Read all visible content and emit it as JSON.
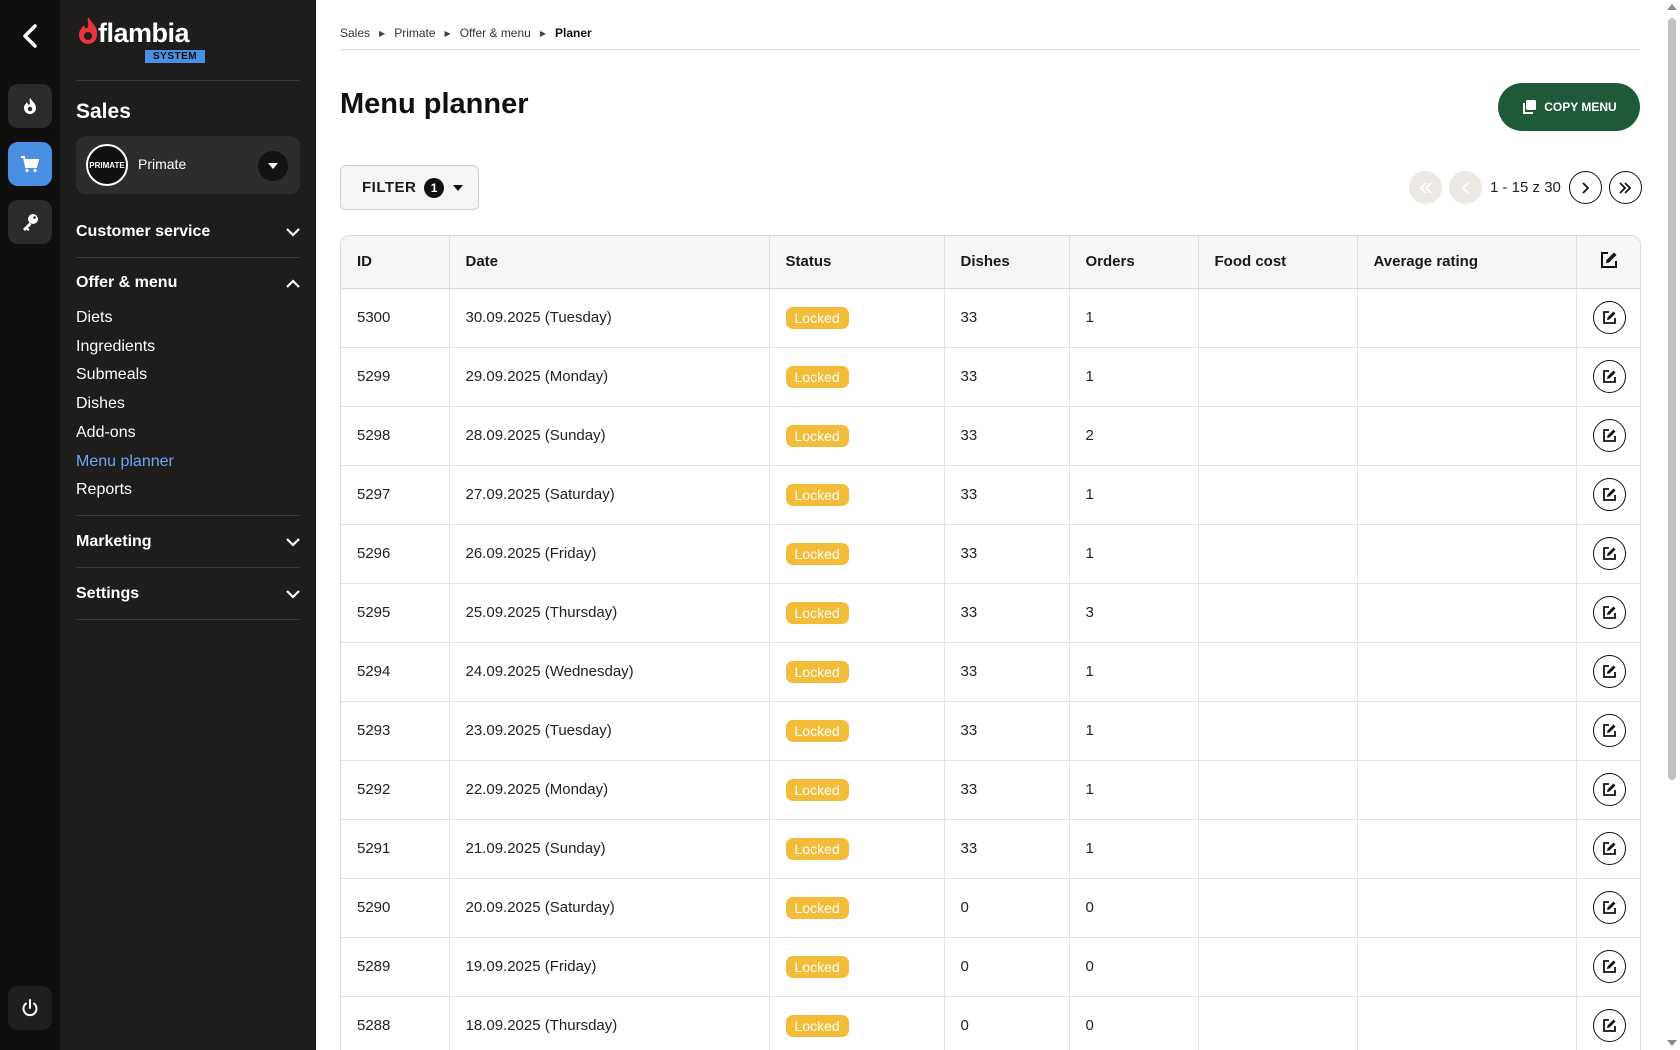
{
  "brand": {
    "name": "flambia",
    "badge": "SYSTEM"
  },
  "sidebar": {
    "section": "Sales",
    "company": {
      "name": "Primate",
      "avatar": "PRIMATE"
    },
    "groups": [
      {
        "label": "Customer service",
        "expanded": false
      },
      {
        "label": "Offer & menu",
        "expanded": true,
        "items": [
          "Diets",
          "Ingredients",
          "Submeals",
          "Dishes",
          "Add-ons",
          "Menu planner",
          "Reports"
        ],
        "active": "Menu planner"
      },
      {
        "label": "Marketing",
        "expanded": false
      },
      {
        "label": "Settings",
        "expanded": false
      }
    ]
  },
  "breadcrumb": [
    "Sales",
    "Primate",
    "Offer & menu",
    "Planer"
  ],
  "page": {
    "title": "Menu planner",
    "copy_button": "COPY MENU",
    "filter_label": "FILTER",
    "filter_count": "1",
    "pagination": "1 - 15 z 30"
  },
  "table": {
    "columns": [
      "ID",
      "Date",
      "Status",
      "Dishes",
      "Orders",
      "Food cost",
      "Average rating"
    ],
    "rows": [
      {
        "id": "5300",
        "date": "30.09.2025 (Tuesday)",
        "status": "Locked",
        "dishes": "33",
        "orders": "1",
        "food_cost": "",
        "rating": ""
      },
      {
        "id": "5299",
        "date": "29.09.2025 (Monday)",
        "status": "Locked",
        "dishes": "33",
        "orders": "1",
        "food_cost": "",
        "rating": ""
      },
      {
        "id": "5298",
        "date": "28.09.2025 (Sunday)",
        "status": "Locked",
        "dishes": "33",
        "orders": "2",
        "food_cost": "",
        "rating": ""
      },
      {
        "id": "5297",
        "date": "27.09.2025 (Saturday)",
        "status": "Locked",
        "dishes": "33",
        "orders": "1",
        "food_cost": "",
        "rating": ""
      },
      {
        "id": "5296",
        "date": "26.09.2025 (Friday)",
        "status": "Locked",
        "dishes": "33",
        "orders": "1",
        "food_cost": "",
        "rating": ""
      },
      {
        "id": "5295",
        "date": "25.09.2025 (Thursday)",
        "status": "Locked",
        "dishes": "33",
        "orders": "3",
        "food_cost": "",
        "rating": ""
      },
      {
        "id": "5294",
        "date": "24.09.2025 (Wednesday)",
        "status": "Locked",
        "dishes": "33",
        "orders": "1",
        "food_cost": "",
        "rating": ""
      },
      {
        "id": "5293",
        "date": "23.09.2025 (Tuesday)",
        "status": "Locked",
        "dishes": "33",
        "orders": "1",
        "food_cost": "",
        "rating": ""
      },
      {
        "id": "5292",
        "date": "22.09.2025 (Monday)",
        "status": "Locked",
        "dishes": "33",
        "orders": "1",
        "food_cost": "",
        "rating": ""
      },
      {
        "id": "5291",
        "date": "21.09.2025 (Sunday)",
        "status": "Locked",
        "dishes": "33",
        "orders": "1",
        "food_cost": "",
        "rating": ""
      },
      {
        "id": "5290",
        "date": "20.09.2025 (Saturday)",
        "status": "Locked",
        "dishes": "0",
        "orders": "0",
        "food_cost": "",
        "rating": ""
      },
      {
        "id": "5289",
        "date": "19.09.2025 (Friday)",
        "status": "Locked",
        "dishes": "0",
        "orders": "0",
        "food_cost": "",
        "rating": ""
      },
      {
        "id": "5288",
        "date": "18.09.2025 (Thursday)",
        "status": "Locked",
        "dishes": "0",
        "orders": "0",
        "food_cost": "",
        "rating": ""
      }
    ]
  },
  "colors": {
    "accent": "#4a90e2",
    "primary_button": "#1e5a3a",
    "status_locked": "#f3bd3a",
    "sidebar_bg": "#1e1d1c",
    "rail_bg": "#0f0f0f"
  },
  "icons": {
    "rail": [
      "back-icon",
      "flame-icon",
      "cart-icon",
      "key-icon",
      "power-icon"
    ]
  }
}
